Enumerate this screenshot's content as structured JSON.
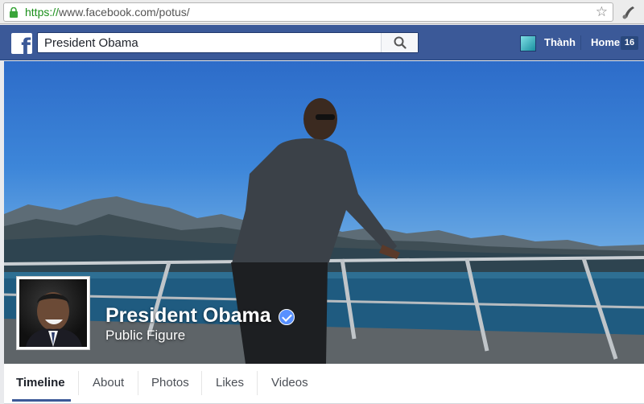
{
  "browser": {
    "url_scheme": "https://",
    "url_rest": "www.facebook.com/potus/"
  },
  "header": {
    "search_value": "President Obama",
    "user_name": "Thành",
    "home_label": "Home",
    "home_count": "16"
  },
  "profile": {
    "name": "President Obama",
    "category": "Public Figure"
  },
  "tabs": [
    {
      "label": "Timeline",
      "active": true
    },
    {
      "label": "About"
    },
    {
      "label": "Photos"
    },
    {
      "label": "Likes"
    },
    {
      "label": "Videos"
    }
  ],
  "colors": {
    "facebook_blue": "#3b5998",
    "verified_blue": "#5890ff"
  }
}
